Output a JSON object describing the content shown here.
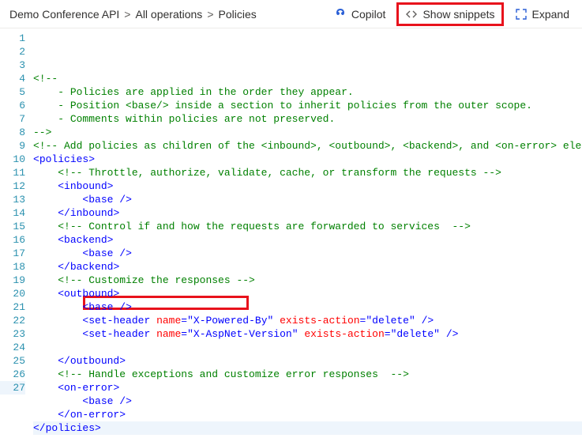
{
  "breadcrumb": {
    "items": [
      "Demo Conference API",
      "All operations",
      "Policies"
    ],
    "sep": ">"
  },
  "toolbar": {
    "copilot": "Copilot",
    "snippets": "Show snippets",
    "expand": "Expand"
  },
  "lines": [
    {
      "n": 1,
      "indent": 0,
      "tokens": [
        [
          "comment",
          "<!--"
        ]
      ]
    },
    {
      "n": 2,
      "indent": 1,
      "tokens": [
        [
          "comment",
          "- Policies are applied in the order they appear."
        ]
      ]
    },
    {
      "n": 3,
      "indent": 1,
      "tokens": [
        [
          "comment",
          "- Position <base/> inside a section to inherit policies from the outer scope."
        ]
      ]
    },
    {
      "n": 4,
      "indent": 1,
      "tokens": [
        [
          "comment",
          "- Comments within policies are not preserved."
        ]
      ]
    },
    {
      "n": 5,
      "indent": 0,
      "tokens": [
        [
          "comment",
          "-->"
        ]
      ]
    },
    {
      "n": 6,
      "indent": 0,
      "tokens": [
        [
          "comment",
          "<!-- Add policies as children of the <inbound>, <outbound>, <backend>, and <on-error> ele"
        ]
      ]
    },
    {
      "n": 7,
      "indent": 0,
      "tokens": [
        [
          "punct",
          "<"
        ],
        [
          "tag",
          "policies"
        ],
        [
          "punct",
          ">"
        ]
      ]
    },
    {
      "n": 8,
      "indent": 1,
      "tokens": [
        [
          "comment",
          "<!-- Throttle, authorize, validate, cache, or transform the requests -->"
        ]
      ]
    },
    {
      "n": 9,
      "indent": 1,
      "tokens": [
        [
          "punct",
          "<"
        ],
        [
          "tag",
          "inbound"
        ],
        [
          "punct",
          ">"
        ]
      ]
    },
    {
      "n": 10,
      "indent": 2,
      "tokens": [
        [
          "punct",
          "<"
        ],
        [
          "tag",
          "base"
        ],
        [
          "text",
          " "
        ],
        [
          "punct",
          "/>"
        ]
      ]
    },
    {
      "n": 11,
      "indent": 1,
      "tokens": [
        [
          "punct",
          "</"
        ],
        [
          "tag",
          "inbound"
        ],
        [
          "punct",
          ">"
        ]
      ]
    },
    {
      "n": 12,
      "indent": 1,
      "tokens": [
        [
          "comment",
          "<!-- Control if and how the requests are forwarded to services  -->"
        ]
      ]
    },
    {
      "n": 13,
      "indent": 1,
      "tokens": [
        [
          "punct",
          "<"
        ],
        [
          "tag",
          "backend"
        ],
        [
          "punct",
          ">"
        ]
      ]
    },
    {
      "n": 14,
      "indent": 2,
      "tokens": [
        [
          "punct",
          "<"
        ],
        [
          "tag",
          "base"
        ],
        [
          "text",
          " "
        ],
        [
          "punct",
          "/>"
        ]
      ]
    },
    {
      "n": 15,
      "indent": 1,
      "tokens": [
        [
          "punct",
          "</"
        ],
        [
          "tag",
          "backend"
        ],
        [
          "punct",
          ">"
        ]
      ]
    },
    {
      "n": 16,
      "indent": 1,
      "tokens": [
        [
          "comment",
          "<!-- Customize the responses -->"
        ]
      ]
    },
    {
      "n": 17,
      "indent": 1,
      "tokens": [
        [
          "punct",
          "<"
        ],
        [
          "tag",
          "outbound"
        ],
        [
          "punct",
          ">"
        ]
      ]
    },
    {
      "n": 18,
      "indent": 2,
      "tokens": [
        [
          "punct",
          "<"
        ],
        [
          "tag",
          "base"
        ],
        [
          "text",
          " "
        ],
        [
          "punct",
          "/>"
        ]
      ]
    },
    {
      "n": 19,
      "indent": 2,
      "tokens": [
        [
          "punct",
          "<"
        ],
        [
          "tag",
          "set-header"
        ],
        [
          "text",
          " "
        ],
        [
          "attr",
          "name"
        ],
        [
          "punct",
          "="
        ],
        [
          "string",
          "\"X-Powered-By\""
        ],
        [
          "text",
          " "
        ],
        [
          "attr",
          "exists-action"
        ],
        [
          "punct",
          "="
        ],
        [
          "string",
          "\"delete\""
        ],
        [
          "text",
          " "
        ],
        [
          "punct",
          "/>"
        ]
      ]
    },
    {
      "n": 20,
      "indent": 2,
      "tokens": [
        [
          "punct",
          "<"
        ],
        [
          "tag",
          "set-header"
        ],
        [
          "text",
          " "
        ],
        [
          "attr",
          "name"
        ],
        [
          "punct",
          "="
        ],
        [
          "string",
          "\"X-AspNet-Version\""
        ],
        [
          "text",
          " "
        ],
        [
          "attr",
          "exists-action"
        ],
        [
          "punct",
          "="
        ],
        [
          "string",
          "\"delete\""
        ],
        [
          "text",
          " "
        ],
        [
          "punct",
          "/>"
        ]
      ]
    },
    {
      "n": 21,
      "indent": 0,
      "tokens": []
    },
    {
      "n": 22,
      "indent": 1,
      "tokens": [
        [
          "punct",
          "</"
        ],
        [
          "tag",
          "outbound"
        ],
        [
          "punct",
          ">"
        ]
      ]
    },
    {
      "n": 23,
      "indent": 1,
      "tokens": [
        [
          "comment",
          "<!-- Handle exceptions and customize error responses  -->"
        ]
      ]
    },
    {
      "n": 24,
      "indent": 1,
      "tokens": [
        [
          "punct",
          "<"
        ],
        [
          "tag",
          "on-error"
        ],
        [
          "punct",
          ">"
        ]
      ]
    },
    {
      "n": 25,
      "indent": 2,
      "tokens": [
        [
          "punct",
          "<"
        ],
        [
          "tag",
          "base"
        ],
        [
          "text",
          " "
        ],
        [
          "punct",
          "/>"
        ]
      ]
    },
    {
      "n": 26,
      "indent": 1,
      "tokens": [
        [
          "punct",
          "</"
        ],
        [
          "tag",
          "on-error"
        ],
        [
          "punct",
          ">"
        ]
      ]
    },
    {
      "n": 27,
      "indent": 0,
      "hl": true,
      "tokens": [
        [
          "punct",
          "</"
        ],
        [
          "tag",
          "policies"
        ],
        [
          "punct",
          ">"
        ]
      ]
    }
  ],
  "highlight_line": 27
}
